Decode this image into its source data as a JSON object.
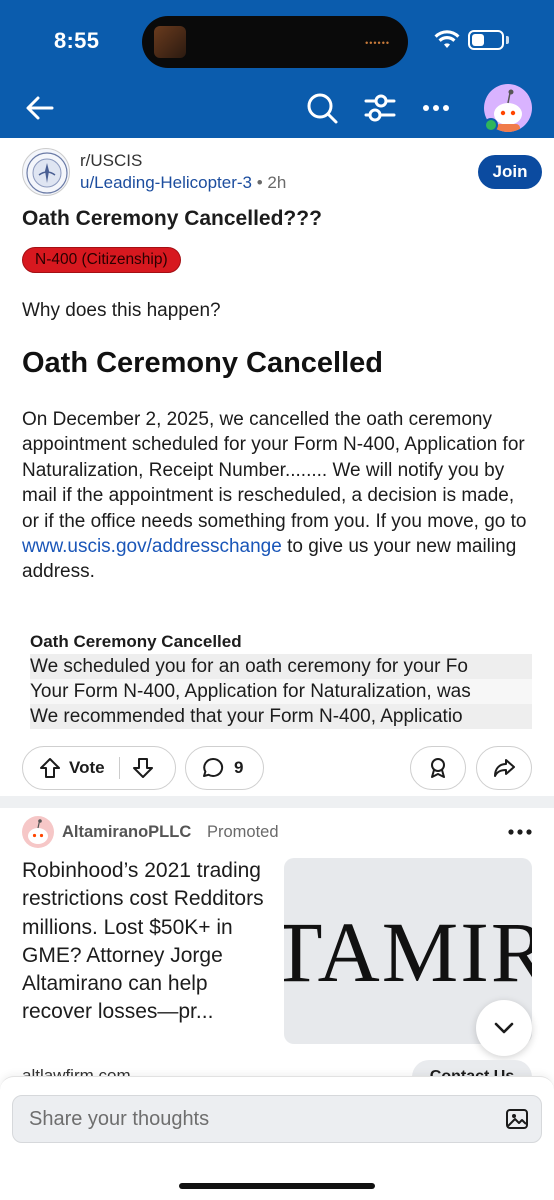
{
  "status_bar": {
    "time": "8:55"
  },
  "nav": {
    "back_icon": "arrow-left-icon",
    "search_icon": "search-icon",
    "filter_icon": "filter-icon",
    "more_icon": "more-horizontal-icon"
  },
  "post": {
    "subreddit": "r/USCIS",
    "author": "u/Leading-Helicopter-3",
    "separator": "•",
    "time": "2h",
    "join_label": "Join",
    "title": "Oath Ceremony Cancelled???",
    "flair": "N-400 (Citizenship)",
    "question": "Why does this happen?",
    "heading": "Oath Ceremony Cancelled",
    "body_before_link": "On December 2, 2025, we cancelled the oath ceremony appointment scheduled for your Form N-400, Application for Naturalization, Receipt Number........ We will notify you by mail if the appointment is rescheduled, a decision is made, or if the office needs something from you. If you move, go to ",
    "link_text": "www.uscis.gov/addresschange",
    "body_after_link": " to give us your new mailing address.",
    "quote_title": "Oath Ceremony Cancelled",
    "quote_lines": [
      "We scheduled you for an oath ceremony for your Fo",
      "Your Form N-400, Application for Naturalization, was",
      "We recommended that your Form N-400, Applicatio"
    ],
    "vote_label": "Vote",
    "comment_count": "9"
  },
  "promoted": {
    "name": "AltamiranoPLLC",
    "tag": "Promoted",
    "text": "Robinhood’s 2021 trading restrictions cost Redditors millions. Lost $50K+ in GME? Attorney Jorge Altamirano can help recover losses—pr...",
    "image_text": "TAMIR",
    "url": "altlawfirm.com",
    "cta": "Contact Us"
  },
  "composer": {
    "placeholder": "Share your thoughts"
  },
  "colors": {
    "header": "#0b5cad",
    "join": "#0b4ba0",
    "flair": "#d7181f",
    "link": "#1a56b8"
  }
}
